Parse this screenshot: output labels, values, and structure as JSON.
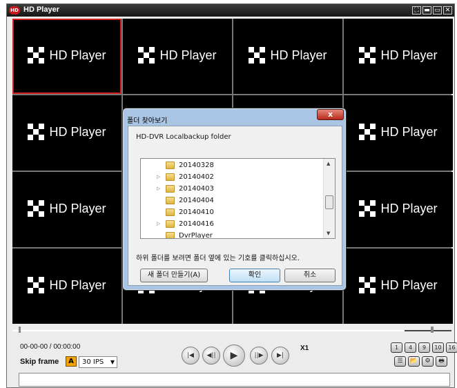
{
  "window": {
    "title": "HD Player",
    "app_icon_text": "HD",
    "buttons": [
      "⛶",
      "▬",
      "▭",
      "✕"
    ]
  },
  "grid": {
    "logo_text": "HD Player",
    "selected_cell": 0,
    "rows": 4,
    "cols": 4
  },
  "dialog": {
    "title": "폴더 찾아보기",
    "close_label": "x",
    "description": "HD-DVR Localbackup folder",
    "folders": [
      {
        "name": "20140328",
        "expandable": false
      },
      {
        "name": "20140402",
        "expandable": true
      },
      {
        "name": "20140403",
        "expandable": true
      },
      {
        "name": "20140404",
        "expandable": false
      },
      {
        "name": "20140410",
        "expandable": false
      },
      {
        "name": "20140416",
        "expandable": true
      },
      {
        "name": "DvrPlayer",
        "expandable": false
      }
    ],
    "hint": "하위 폴더를 보려면 폴더 옆에 있는 기호를 클릭하십시오.",
    "new_folder_label": "새 폴더 만들기(A)",
    "ok_label": "확인",
    "cancel_label": "취소"
  },
  "controls": {
    "time": "00-00-00 / 00:00:00",
    "skip_frame_label": "Skip frame",
    "skip_badge": "A",
    "ips_value": "30 IPS",
    "speed": "X1",
    "layout_buttons": [
      "1",
      "4",
      "9",
      "10",
      "16"
    ],
    "tool_icons": [
      "list-icon",
      "folder-open-icon",
      "settings-icon",
      "print-icon"
    ]
  },
  "colors": {
    "accent_red": "#d21f1f",
    "skip_badge": "#f2a400",
    "dialog_frame": "#a9c5e3"
  }
}
